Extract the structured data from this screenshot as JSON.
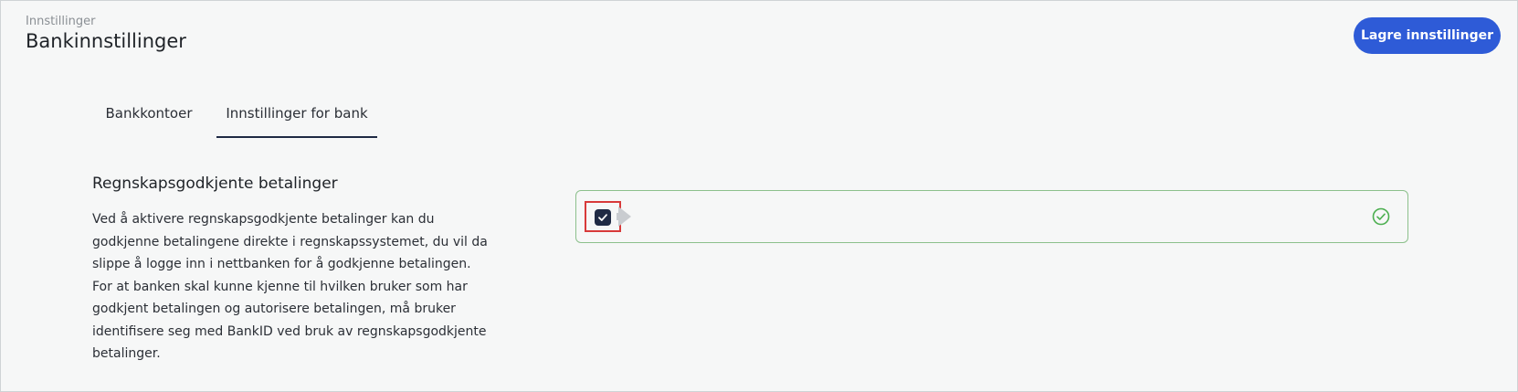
{
  "header": {
    "breadcrumb": "Innstillinger",
    "title": "Bankinnstillinger",
    "save_label": "Lagre innstillinger"
  },
  "tabs": [
    {
      "label": "Bankkontoer",
      "active": false
    },
    {
      "label": "Innstillinger for bank",
      "active": true
    }
  ],
  "section": {
    "title": "Regnskapsgodkjente betalinger",
    "description": "Ved å aktivere regnskapsgodkjente betalinger kan du godkjenne betalingene direkte i regnskapssystemet, du vil da slippe å logge inn i nettbanken for å godkjenne betalingen. For at banken skal kunne kjenne til hvilken bruker som har godkjent betalingen og autorisere betalingen, må bruker identifisere seg med BankID ved bruk av regnskapsgodkjente betalinger."
  },
  "setting": {
    "checked": true,
    "status_icon": "check-circle-icon",
    "checkbox_icon": "checkmark-icon"
  },
  "colors": {
    "accent": "#2e5bd7",
    "checkbox": "#1f2a44",
    "success": "#4caf50",
    "focus": "#d83a3a"
  }
}
